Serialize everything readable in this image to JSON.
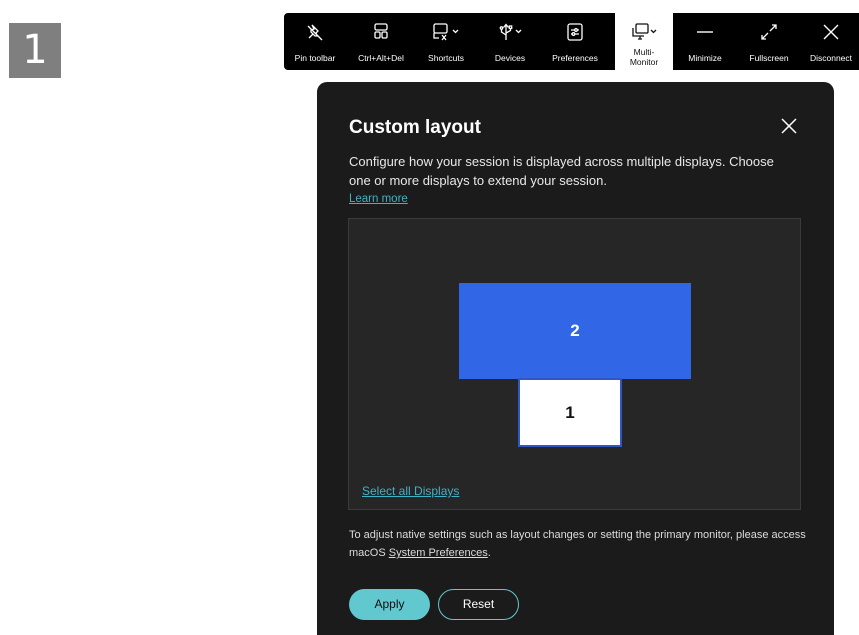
{
  "step_badge": "1",
  "toolbar": {
    "items": [
      {
        "label": "Pin toolbar",
        "icon": "pin-icon"
      },
      {
        "label": "Ctrl+Alt+Del",
        "icon": "keyboard-keys-icon"
      },
      {
        "label": "Shortcuts",
        "icon": "shortcuts-icon"
      },
      {
        "label": "Devices",
        "icon": "usb-icon"
      },
      {
        "label": "Preferences",
        "icon": "preferences-icon"
      },
      {
        "label_line1": "Multi-",
        "label_line2": "Monitor",
        "icon": "multi-monitor-icon",
        "active": true
      },
      {
        "label": "Minimize",
        "icon": "minimize-icon"
      },
      {
        "label": "Fullscreen",
        "icon": "fullscreen-icon"
      },
      {
        "label": "Disconnect",
        "icon": "close-icon"
      }
    ]
  },
  "dialog": {
    "title": "Custom layout",
    "description": "Configure how your session is displayed across multiple displays. Choose one or more displays to extend your session.",
    "learn_more": "Learn more",
    "monitors": [
      {
        "number": "2",
        "color": "#3167e6"
      },
      {
        "number": "1",
        "color": "#ffffff"
      }
    ],
    "select_all": "Select all Displays",
    "native_note_prefix": "To adjust native settings such as layout changes or setting the primary monitor, please access macOS ",
    "native_note_link": "System Preferences",
    "native_note_suffix": ".",
    "apply": "Apply",
    "reset": "Reset"
  },
  "colors": {
    "accent": "#61c8d0",
    "link": "#3fb3c6",
    "dialog_bg": "#1b1b1b",
    "monitor_selected": "#3167e6"
  }
}
